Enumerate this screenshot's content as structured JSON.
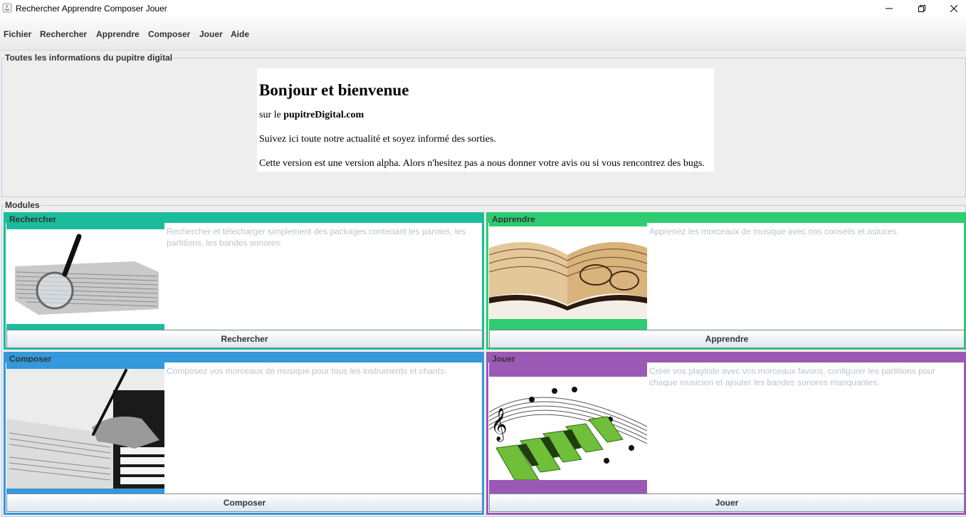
{
  "window": {
    "title": "Rechercher Apprendre Composer Jouer"
  },
  "menu": [
    "Fichier",
    "Rechercher",
    "Apprendre",
    "Composer",
    "Jouer",
    "Aide"
  ],
  "info": {
    "group_title": "Toutes les informations du pupitre digital",
    "heading": "Bonjour et bienvenue",
    "line1_prefix": "sur le ",
    "line1_bold": "pupitreDigital.com",
    "line2": "Suivez ici toute notre actualité et soyez informé des sorties.",
    "line3": "Cette version est une version alpha. Alors n'hesitez pas a nous donner votre avis ou si vous rencontrez des bugs."
  },
  "modules": {
    "group_title": "Modules",
    "rechercher": {
      "title": "Rechercher",
      "description": "Rechercher et télecharger simplement des packages contenant les paroles, les partitions, les bandes sonores.",
      "button": "Rechercher",
      "color": "#1abc9c"
    },
    "apprendre": {
      "title": "Apprendre",
      "description": "Apprenez les morceaux de musique avec nos conseils et astuces.",
      "button": "Apprendre",
      "color": "#2ecc71"
    },
    "composer": {
      "title": "Composer",
      "description": "Composez vos morceaux de musique pour tous les instruments et chants.",
      "button": "Composer",
      "color": "#3498db"
    },
    "jouer": {
      "title": "Jouer",
      "description": "Créer vos playliste avec vos morceaux favoris, configurer les partitions pour chaque musicien et ajouter les bandes sonores manquantes.",
      "button": "Jouer",
      "color": "#9b59b6"
    }
  }
}
